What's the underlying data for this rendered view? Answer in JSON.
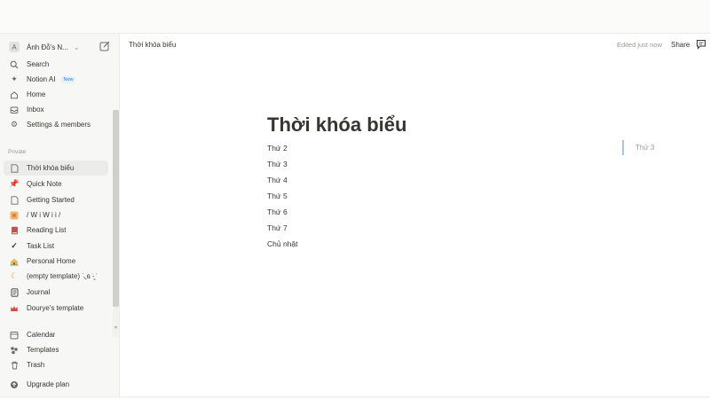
{
  "workspace": {
    "avatar_letter": "A",
    "name": "Ánh Đỗ's N..."
  },
  "sidebar": {
    "top_items": [
      {
        "label": "Search",
        "icon": "search-icon"
      },
      {
        "label": "Notion AI",
        "icon": "notion-ai-icon",
        "badge": "New"
      },
      {
        "label": "Home",
        "icon": "home-icon"
      },
      {
        "label": "Inbox",
        "icon": "inbox-icon"
      },
      {
        "label": "Settings & members",
        "icon": "gear-icon"
      }
    ],
    "section_label": "Private",
    "pages": [
      {
        "label": "Thời khóa biểu",
        "icon": "page-icon",
        "active": true
      },
      {
        "label": "Quick Note",
        "icon": "pushpin-icon"
      },
      {
        "label": "Getting Started",
        "icon": "page-icon"
      },
      {
        "label": "/ W i W i i /",
        "icon": "emoji-icon"
      },
      {
        "label": "Reading List",
        "icon": "book-icon"
      },
      {
        "label": "Task List",
        "icon": "checkmark-icon"
      },
      {
        "label": "Personal Home",
        "icon": "house-emoji-icon"
      },
      {
        "label": "(empty template) ͘ ◟ɞ ̇-̫ ̇",
        "icon": "emoji-icon"
      },
      {
        "label": "Journal",
        "icon": "journal-icon"
      },
      {
        "label": "Dourye's template",
        "icon": "crown-icon"
      }
    ],
    "bottom_items": [
      {
        "label": "Calendar",
        "icon": "calendar-icon"
      },
      {
        "label": "Templates",
        "icon": "templates-icon"
      },
      {
        "label": "Trash",
        "icon": "trash-icon"
      }
    ],
    "upgrade_label": "Upgrade plan"
  },
  "header": {
    "breadcrumb": "Thời khóa biểu",
    "edited": "Edited just now",
    "share": "Share"
  },
  "page": {
    "title": "Thời khóa biểu",
    "blocks": [
      "Thứ 2",
      "Thứ 3",
      "Thứ 4",
      "Thứ 5",
      "Thứ 6",
      "Thứ 7",
      "Chủ nhật"
    ],
    "toc_item": "Thứ 3"
  },
  "colors": {
    "sidebar_bg": "#f7f7f5",
    "text": "#37352f",
    "muted": "#9b9a97",
    "accent": "#2383e2"
  }
}
